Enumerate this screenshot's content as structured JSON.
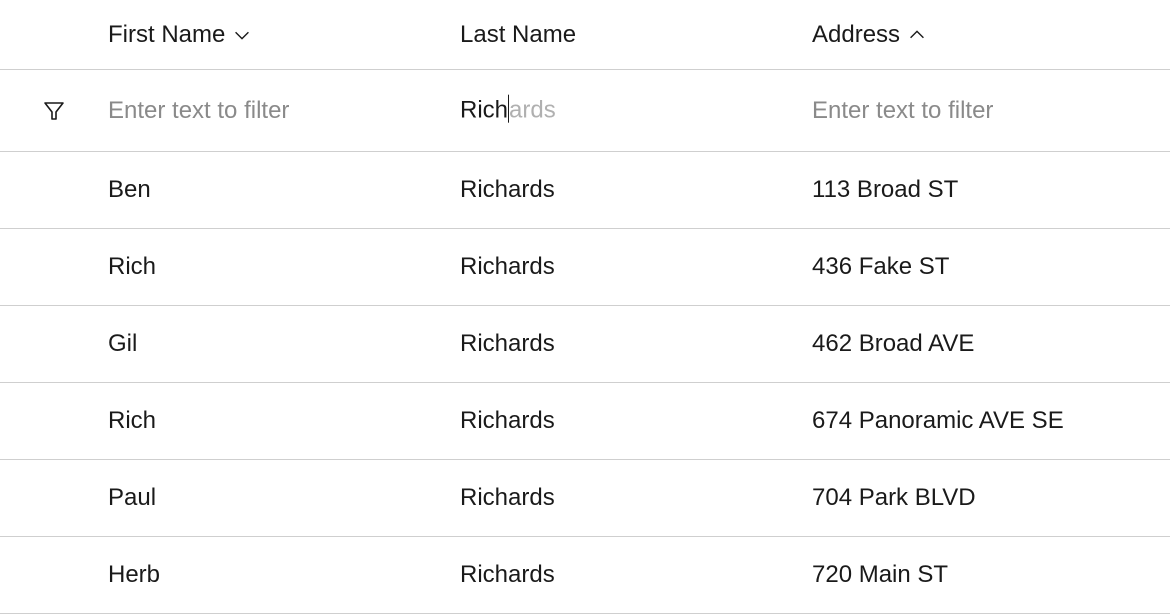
{
  "columns": {
    "first_name": {
      "label": "First Name",
      "sort": "desc"
    },
    "last_name": {
      "label": "Last Name",
      "sort": "none"
    },
    "address": {
      "label": "Address",
      "sort": "asc"
    }
  },
  "filter": {
    "placeholder": "Enter text to filter",
    "first_name": "",
    "last_name_typed": "Rich",
    "last_name_ghost": "ards",
    "address": ""
  },
  "rows": [
    {
      "first_name": "Ben",
      "last_name": "Richards",
      "address": "113 Broad ST"
    },
    {
      "first_name": "Rich",
      "last_name": "Richards",
      "address": "436 Fake ST"
    },
    {
      "first_name": "Gil",
      "last_name": "Richards",
      "address": "462 Broad AVE"
    },
    {
      "first_name": "Rich",
      "last_name": "Richards",
      "address": "674 Panoramic AVE SE"
    },
    {
      "first_name": "Paul",
      "last_name": "Richards",
      "address": "704 Park BLVD"
    },
    {
      "first_name": "Herb",
      "last_name": "Richards",
      "address": "720 Main ST"
    }
  ]
}
